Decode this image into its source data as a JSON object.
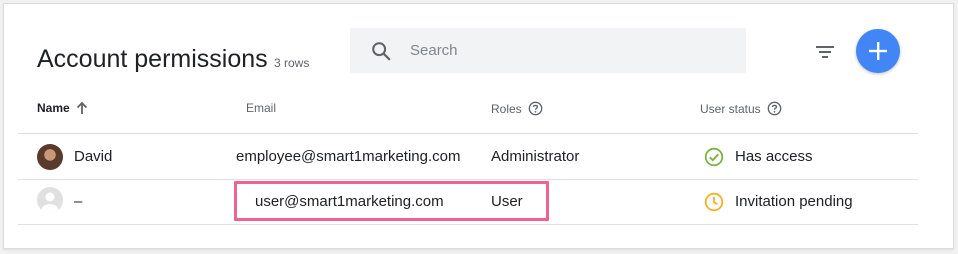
{
  "header": {
    "title": "Account permissions",
    "row_count": "3 rows"
  },
  "search": {
    "placeholder": "Search",
    "icon": "search-icon"
  },
  "toolbar": {
    "filter_icon": "filter-icon",
    "add_icon": "add-icon",
    "accent_color": "#4285f4"
  },
  "table": {
    "columns": {
      "name": "Name",
      "email": "Email",
      "roles": "Roles",
      "status": "User status"
    },
    "rows": [
      {
        "name": "David",
        "email": "employee@smart1marketing.com",
        "role": "Administrator",
        "status": "Has access",
        "status_color": "#7cb342"
      },
      {
        "name": "–",
        "email": "user@smart1marketing.com",
        "role": "User",
        "status": "Invitation pending",
        "status_color": "#f6b026"
      }
    ]
  },
  "highlight_color": "#f06292"
}
